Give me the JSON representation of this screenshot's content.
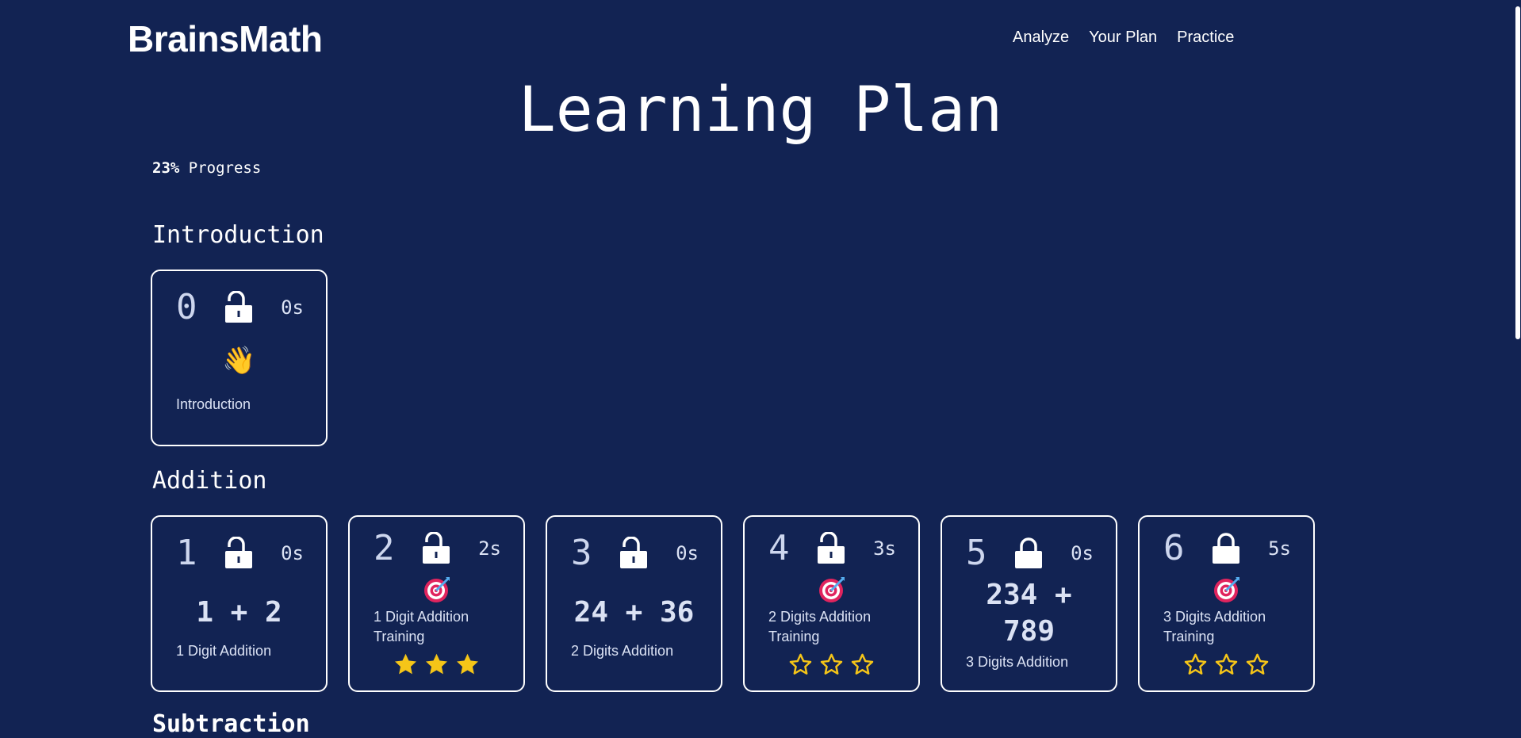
{
  "header": {
    "logo": "BrainsMath",
    "nav": [
      {
        "label": "Analyze"
      },
      {
        "label": "Your Plan"
      },
      {
        "label": "Practice"
      }
    ]
  },
  "page": {
    "title": "Learning Plan",
    "progress_value": "23%",
    "progress_label": "Progress",
    "progress_fraction": 0.23
  },
  "sections": [
    {
      "title": "Introduction",
      "lessons": [
        {
          "number": "0",
          "lock": "unlocked-padlock-icon",
          "time": "0s",
          "icon": "waving-hand-icon",
          "emoji": "👋",
          "label": "Introduction"
        }
      ]
    },
    {
      "title": "Addition",
      "lessons": [
        {
          "number": "1",
          "lock": "unlocked-padlock-icon",
          "time": "0s",
          "expression": "1 + 2",
          "label": "1 Digit Addition"
        },
        {
          "number": "2",
          "lock": "unlocked-padlock-icon",
          "time": "2s",
          "icon": "target-icon",
          "label": "1 Digit Addition Training",
          "stars_filled": 3,
          "stars_total": 3
        },
        {
          "number": "3",
          "lock": "unlocked-padlock-icon",
          "time": "0s",
          "expression": "24 + 36",
          "label": "2 Digits Addition"
        },
        {
          "number": "4",
          "lock": "unlocked-padlock-icon",
          "time": "3s",
          "icon": "target-icon",
          "label": "2 Digits Addition Training",
          "stars_filled": 0,
          "stars_total": 3
        },
        {
          "number": "5",
          "lock": "locked-padlock-icon",
          "time": "0s",
          "expression": "234 + 789",
          "label": "3 Digits Addition"
        },
        {
          "number": "6",
          "lock": "locked-padlock-icon",
          "time": "5s",
          "icon": "target-icon",
          "label": "3 Digits Addition Training",
          "stars_filled": 0,
          "stars_total": 3
        }
      ]
    },
    {
      "title": "Subtraction"
    }
  ],
  "colors": {
    "background": "#122353",
    "text": "#ffffff",
    "muted_text": "#dbe2f4",
    "star": "#f5c518"
  }
}
